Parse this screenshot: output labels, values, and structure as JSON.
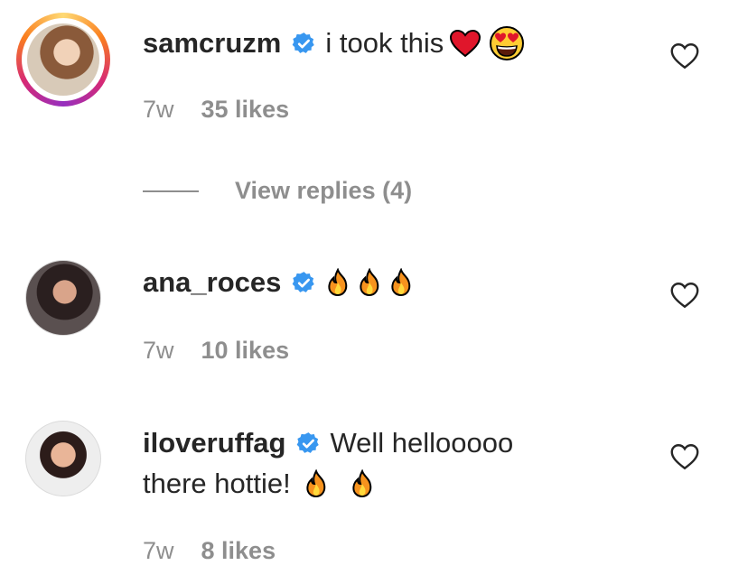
{
  "comments": [
    {
      "username": "samcruzm",
      "text": "i took this",
      "emojis": [
        "heart",
        "heart-eyes"
      ],
      "time": "7w",
      "likes": "35 likes",
      "replies_label": "View replies (4)"
    },
    {
      "username": "ana_roces",
      "text": "",
      "emojis": [
        "fire",
        "fire",
        "fire"
      ],
      "time": "7w",
      "likes": "10 likes"
    },
    {
      "username": "iloveruffag",
      "text": "Well hellooooo",
      "text_line2": "there hottie!",
      "emojis": [
        "fire",
        "fire"
      ],
      "time": "7w",
      "likes": "8 likes"
    }
  ],
  "colors": {
    "verified": "#3897f0",
    "muted": "#8e8e8e",
    "text": "#262626"
  }
}
